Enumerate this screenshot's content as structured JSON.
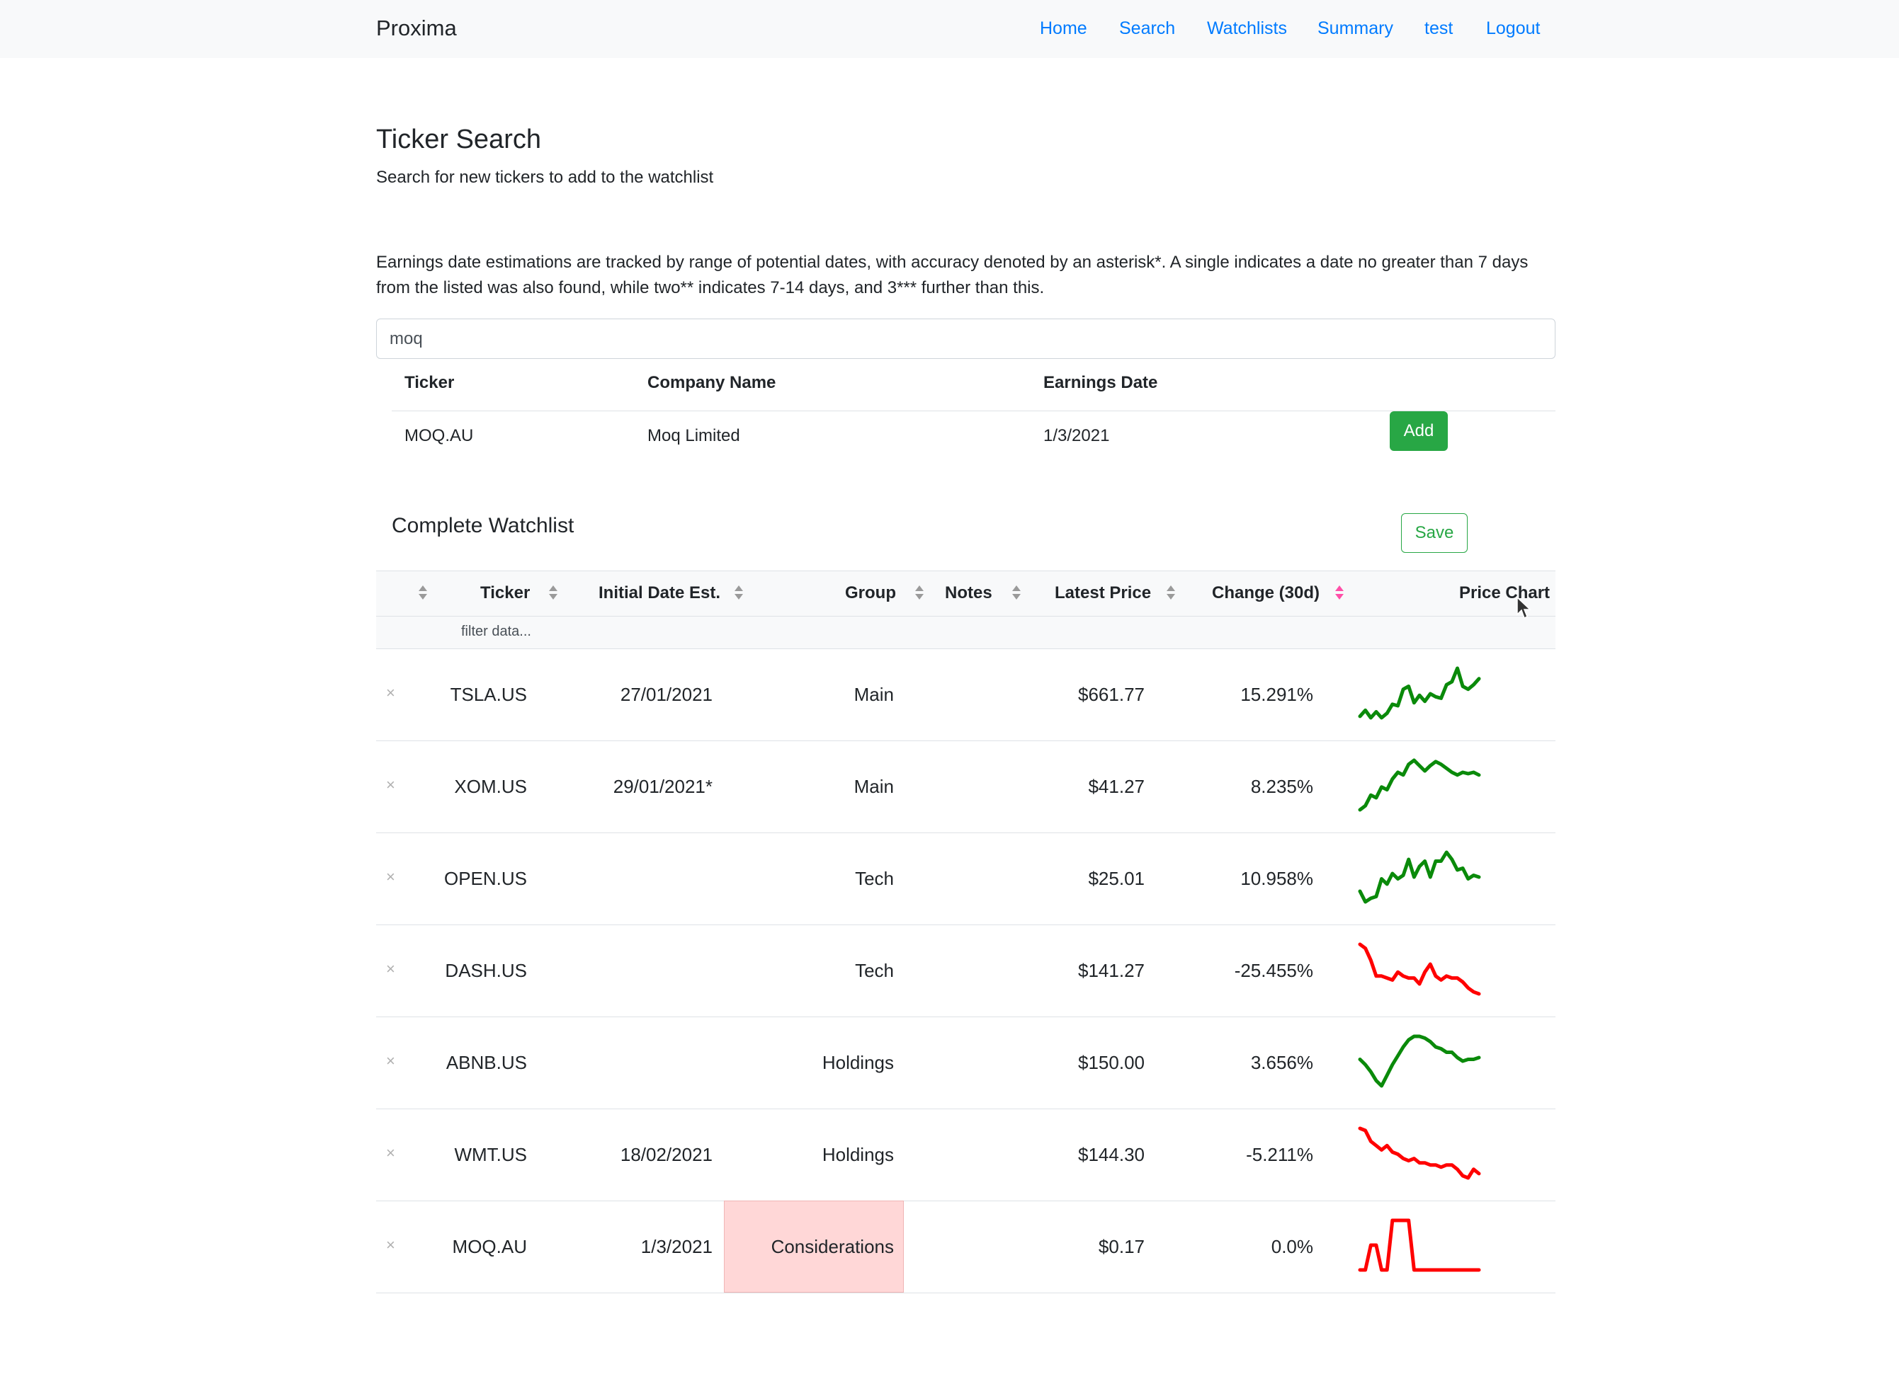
{
  "nav": {
    "brand": "Proxima",
    "links": [
      "Home",
      "Search",
      "Watchlists",
      "Summary",
      "test",
      "Logout"
    ]
  },
  "search_section": {
    "title": "Ticker Search",
    "subtitle": "Search for new tickers to add to the watchlist",
    "info": "Earnings date estimations are tracked by range of potential dates, with accuracy denoted by an asterisk*. A single indicates a date no greater than 7 days from the listed was also found, while two** indicates 7-14 days, and 3*** further than this.",
    "query": "moq"
  },
  "results": {
    "headers": [
      "Ticker",
      "Company Name",
      "Earnings Date"
    ],
    "rows": [
      {
        "ticker": "MOQ.AU",
        "company": "Moq Limited",
        "earnings": "1/3/2021",
        "action": "Add"
      }
    ]
  },
  "watchlist": {
    "title": "Complete Watchlist",
    "save_label": "Save",
    "headers": [
      "Ticker",
      "Initial Date Est.",
      "Group",
      "Notes",
      "Latest Price",
      "Change (30d)",
      "Price Chart"
    ],
    "filter_placeholder": "filter data...",
    "remove_glyph": "×",
    "colors": {
      "up": "#0a8a0a",
      "down": "#ff0000",
      "sort_active": "#ff4fa8",
      "sort_idle": "#9a9a9a"
    },
    "rows": [
      {
        "ticker": "TSLA.US",
        "date": "27/01/2021",
        "group": "Main",
        "notes": "",
        "price": "$661.77",
        "change": "15.291%",
        "trend": "up",
        "spark": [
          10,
          14,
          9,
          13,
          9,
          12,
          18,
          17,
          28,
          30,
          19,
          24,
          20,
          25,
          23,
          22,
          31,
          33,
          42,
          30,
          28,
          31,
          35
        ]
      },
      {
        "ticker": "XOM.US",
        "date": "29/01/2021*",
        "group": "Main",
        "notes": "",
        "price": "$41.27",
        "change": "8.235%",
        "trend": "up",
        "spark": [
          5,
          8,
          16,
          14,
          22,
          20,
          28,
          33,
          31,
          39,
          42,
          38,
          34,
          38,
          41,
          39,
          36,
          33,
          31,
          33,
          32,
          33,
          31
        ]
      },
      {
        "ticker": "OPEN.US",
        "date": "",
        "group": "Tech",
        "notes": "",
        "price": "$25.01",
        "change": "10.958%",
        "trend": "up",
        "spark": [
          14,
          8,
          10,
          11,
          21,
          18,
          24,
          21,
          23,
          32,
          22,
          28,
          31,
          22,
          31,
          31,
          36,
          32,
          26,
          27,
          21,
          23,
          22
        ]
      },
      {
        "ticker": "DASH.US",
        "date": "",
        "group": "Tech",
        "notes": "",
        "price": "$141.27",
        "change": "-25.455%",
        "trend": "down",
        "spark": [
          38,
          36,
          30,
          22,
          22,
          21,
          20,
          24,
          22,
          21,
          21,
          18,
          24,
          28,
          22,
          20,
          22,
          21,
          21,
          19,
          16,
          14,
          13
        ]
      },
      {
        "ticker": "ABNB.US",
        "date": "",
        "group": "Holdings",
        "notes": "",
        "price": "$150.00",
        "change": "3.656%",
        "trend": "up",
        "spark": [
          30,
          27,
          23,
          18,
          15,
          21,
          27,
          32,
          37,
          41,
          43,
          43,
          42,
          40,
          37,
          36,
          34,
          34,
          31,
          29,
          30,
          30,
          31
        ]
      },
      {
        "ticker": "WMT.US",
        "date": "18/02/2021",
        "group": "Holdings",
        "notes": "",
        "price": "$144.30",
        "change": "-5.211%",
        "trend": "down",
        "spark": [
          40,
          39,
          34,
          32,
          30,
          32,
          29,
          28,
          26,
          25,
          26,
          24,
          24,
          23,
          23,
          22,
          23,
          23,
          21,
          18,
          17,
          21,
          19
        ]
      },
      {
        "ticker": "MOQ.AU",
        "date": "1/3/2021",
        "group": "Considerations",
        "notes": "",
        "price": "$0.17",
        "change": "0.0%",
        "trend": "down",
        "highlight": true,
        "spark": [
          5,
          5,
          15,
          15,
          5,
          5,
          25,
          25,
          25,
          25,
          5,
          5,
          5,
          5,
          5,
          5,
          5,
          5,
          5,
          5,
          5,
          5,
          5
        ]
      }
    ]
  }
}
